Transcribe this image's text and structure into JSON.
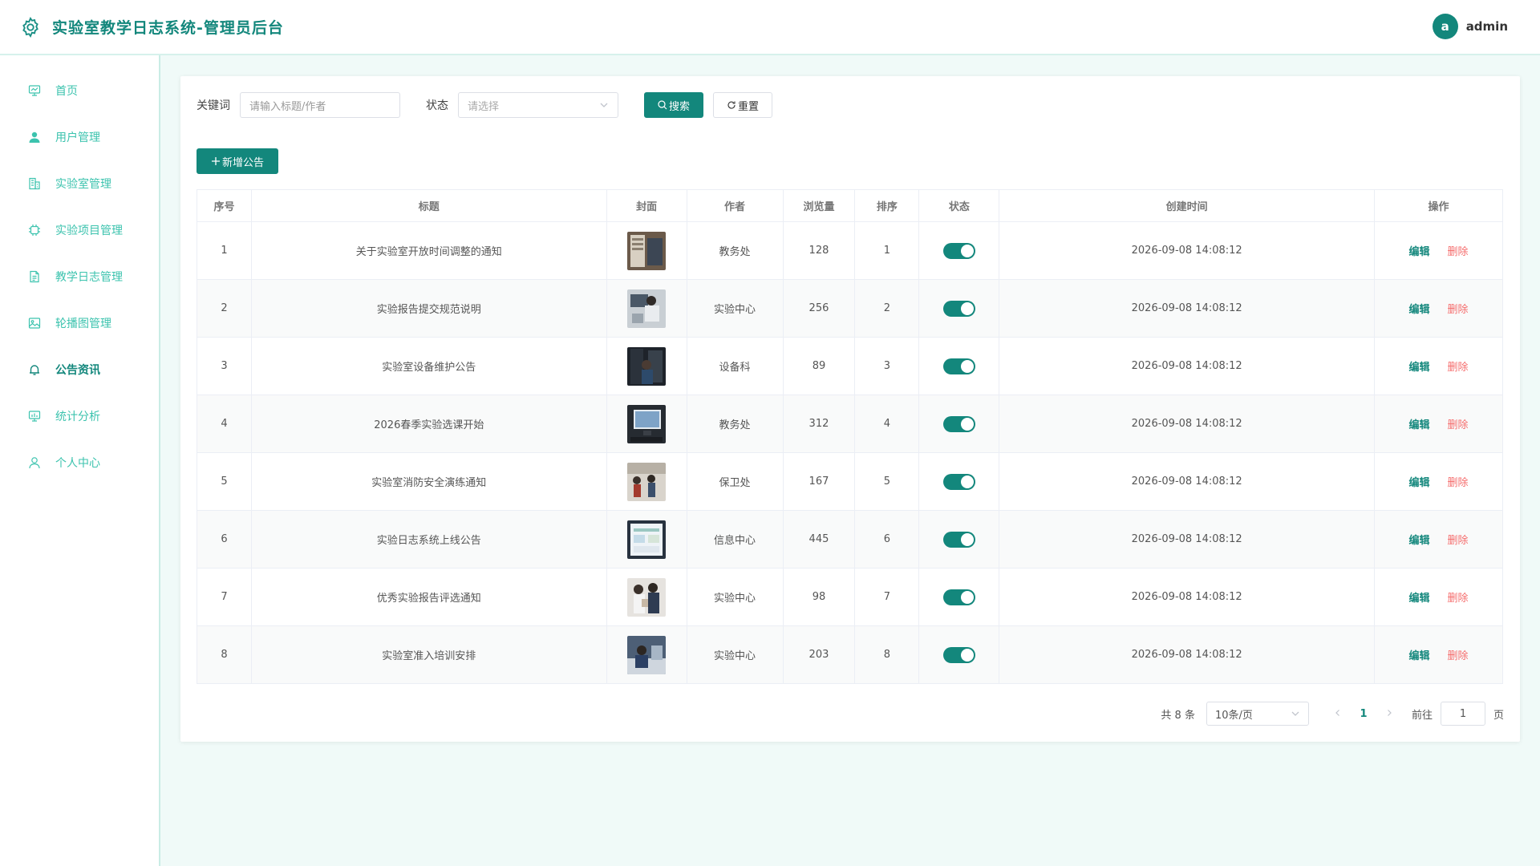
{
  "app": {
    "title": "实验室教学日志系统-管理员后台"
  },
  "user": {
    "avatar_letter": "a",
    "name": "admin"
  },
  "sidebar": {
    "items": [
      {
        "label": "首页",
        "icon": "dashboard-icon"
      },
      {
        "label": "用户管理",
        "icon": "user-icon"
      },
      {
        "label": "实验室管理",
        "icon": "building-icon"
      },
      {
        "label": "实验项目管理",
        "icon": "cpu-icon"
      },
      {
        "label": "教学日志管理",
        "icon": "document-icon"
      },
      {
        "label": "轮播图管理",
        "icon": "picture-icon"
      },
      {
        "label": "公告资讯",
        "icon": "bell-icon",
        "active": true
      },
      {
        "label": "统计分析",
        "icon": "chart-icon"
      },
      {
        "label": "个人中心",
        "icon": "person-icon"
      }
    ]
  },
  "filters": {
    "keyword_label": "关键词",
    "keyword_placeholder": "请输入标题/作者",
    "status_label": "状态",
    "status_placeholder": "请选择",
    "search_label": "搜索",
    "reset_label": "重置"
  },
  "toolbar": {
    "add_label": "新增公告"
  },
  "table": {
    "headers": [
      "序号",
      "标题",
      "封面",
      "作者",
      "浏览量",
      "排序",
      "状态",
      "创建时间",
      "操作"
    ],
    "edit_label": "编辑",
    "delete_label": "删除",
    "rows": [
      {
        "index": "1",
        "title": "关于实验室开放时间调整的通知",
        "author": "教务处",
        "views": "128",
        "sort": "1",
        "status": true,
        "created": "2026-09-08 14:08:12"
      },
      {
        "index": "2",
        "title": "实验报告提交规范说明",
        "author": "实验中心",
        "views": "256",
        "sort": "2",
        "status": true,
        "created": "2026-09-08 14:08:12"
      },
      {
        "index": "3",
        "title": "实验室设备维护公告",
        "author": "设备科",
        "views": "89",
        "sort": "3",
        "status": true,
        "created": "2026-09-08 14:08:12"
      },
      {
        "index": "4",
        "title": "2026春季实验选课开始",
        "author": "教务处",
        "views": "312",
        "sort": "4",
        "status": true,
        "created": "2026-09-08 14:08:12"
      },
      {
        "index": "5",
        "title": "实验室消防安全演练通知",
        "author": "保卫处",
        "views": "167",
        "sort": "5",
        "status": true,
        "created": "2026-09-08 14:08:12"
      },
      {
        "index": "6",
        "title": "实验日志系统上线公告",
        "author": "信息中心",
        "views": "445",
        "sort": "6",
        "status": true,
        "created": "2026-09-08 14:08:12"
      },
      {
        "index": "7",
        "title": "优秀实验报告评选通知",
        "author": "实验中心",
        "views": "98",
        "sort": "7",
        "status": true,
        "created": "2026-09-08 14:08:12"
      },
      {
        "index": "8",
        "title": "实验室准入培训安排",
        "author": "实验中心",
        "views": "203",
        "sort": "8",
        "status": true,
        "created": "2026-09-08 14:08:12"
      }
    ]
  },
  "pagination": {
    "total_text": "共 8 条",
    "page_size": "10条/页",
    "current_page": "1",
    "goto_label": "前往",
    "goto_value": "1",
    "page_suffix": "页"
  },
  "colors": {
    "primary": "#13877c",
    "accent": "#3cc3ae",
    "danger": "#f56c6c"
  }
}
